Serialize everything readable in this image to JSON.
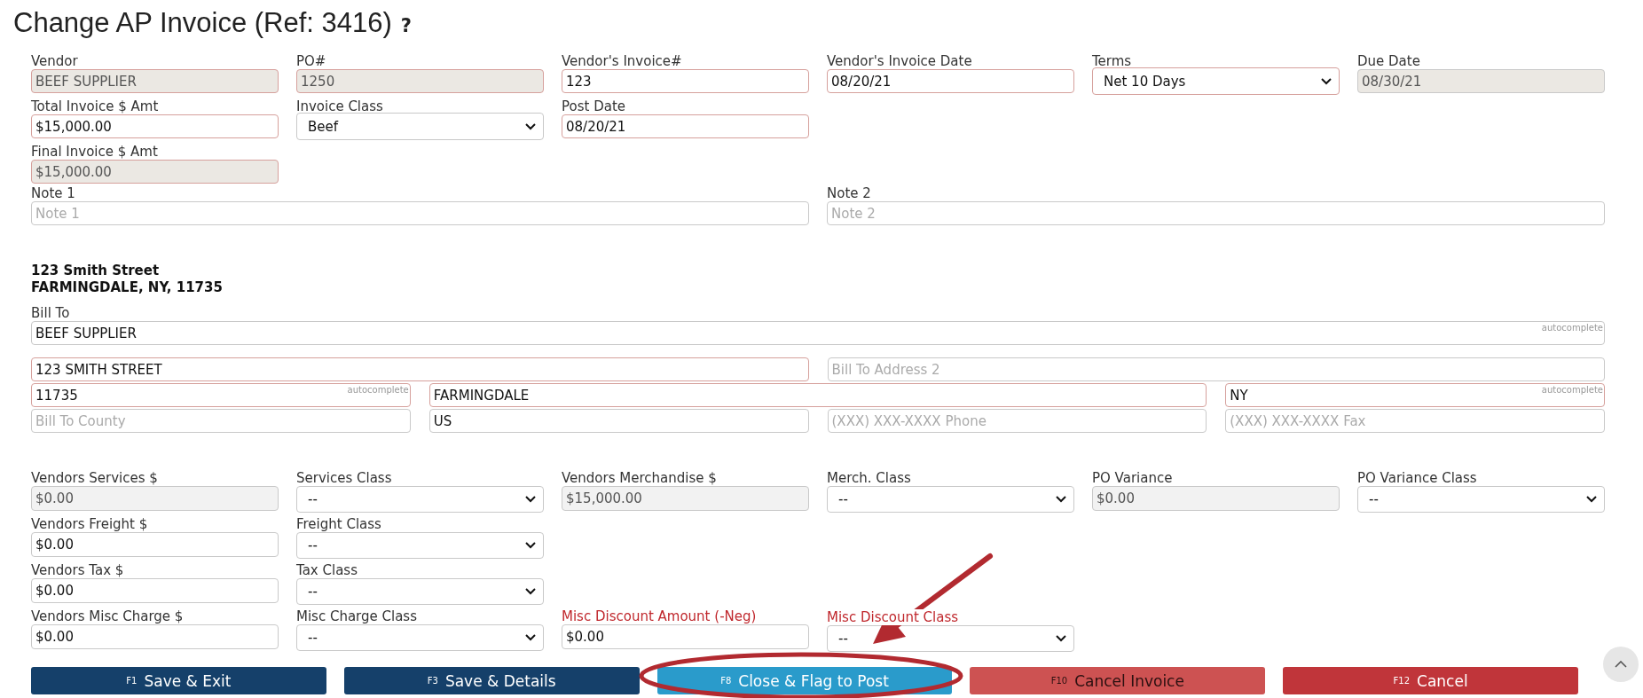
{
  "title": "Change AP Invoice (Ref: 3416)",
  "help": "?",
  "header_rows": [
    [
      {
        "label": "Vendor",
        "kind": "input",
        "value": "BEEF SUPPLIER",
        "readonly": true,
        "required": true
      },
      {
        "label": "PO#",
        "kind": "input",
        "value": "1250",
        "readonly": true,
        "required": true
      },
      {
        "label": "Vendor's Invoice#",
        "kind": "input",
        "value": "123",
        "readonly": false,
        "required": true
      },
      {
        "label": "Vendor's Invoice Date",
        "kind": "input",
        "value": "08/20/21",
        "readonly": false,
        "required": true
      },
      {
        "label": "Terms",
        "kind": "select",
        "value": "Net 10 Days",
        "required": true
      },
      {
        "label": "Due Date",
        "kind": "input",
        "value": "08/30/21",
        "readonly": true,
        "required": false
      }
    ],
    [
      {
        "label": "Total Invoice $ Amt",
        "kind": "input",
        "value": "$15,000.00",
        "readonly": false,
        "required": true
      },
      {
        "label": "Invoice Class",
        "kind": "select",
        "value": "Beef",
        "required": false
      },
      {
        "label": "Post Date",
        "kind": "input",
        "value": "08/20/21",
        "readonly": false,
        "required": true
      }
    ],
    [
      {
        "label": "Final Invoice $ Amt",
        "kind": "input",
        "value": "$15,000.00",
        "readonly": true,
        "required": true
      }
    ]
  ],
  "notes": [
    {
      "label": "Note 1",
      "kind": "input",
      "placeholder": "Note 1",
      "readonly": false,
      "required": false
    },
    {
      "label": "Note 2",
      "kind": "input",
      "placeholder": "Note 2",
      "readonly": false,
      "required": false
    }
  ],
  "vendor_address": [
    "123 Smith Street",
    "FARMINGDALE, NY, 11735"
  ],
  "bill_to_fields": [
    {
      "label": "Bill To",
      "kind": "input",
      "value": "BEEF SUPPLIER",
      "hint": "autocomplete",
      "readonly": false,
      "required": false
    },
    {
      "kind": "input",
      "value": "123 SMITH STREET",
      "readonly": false,
      "required": true
    },
    {
      "kind": "input",
      "placeholder": "Bill To Address 2",
      "readonly": false,
      "required": false
    },
    {
      "kind": "input",
      "value": "11735",
      "hint": "autocomplete",
      "readonly": false,
      "required": true
    },
    {
      "kind": "input",
      "value": "FARMINGDALE",
      "readonly": false,
      "required": true
    },
    {
      "kind": "input",
      "value": "NY",
      "hint": "autocomplete",
      "readonly": false,
      "required": true
    },
    {
      "kind": "input",
      "placeholder": "Bill To County",
      "readonly": false,
      "required": false
    },
    {
      "kind": "input",
      "value": "US",
      "readonly": false,
      "required": false
    },
    {
      "kind": "input",
      "placeholder": "(XXX) XXX-XXXX Phone",
      "readonly": false,
      "required": false
    },
    {
      "kind": "input",
      "placeholder": "(XXX) XXX-XXXX Fax",
      "readonly": false,
      "required": false
    }
  ],
  "charge_rows": [
    [
      {
        "label": "Vendors Services $",
        "kind": "input",
        "value": "$0.00",
        "readonly": true,
        "required": false
      },
      {
        "label": "Services Class",
        "kind": "select",
        "value": "--",
        "required": false
      },
      {
        "label": "Vendors Merchandise $",
        "kind": "input",
        "value": "$15,000.00",
        "readonly": true,
        "required": false
      },
      {
        "label": "Merch. Class",
        "kind": "select",
        "value": "--",
        "required": false
      },
      {
        "label": "PO Variance",
        "kind": "input",
        "value": "$0.00",
        "readonly": true,
        "required": false
      },
      {
        "label": "PO Variance Class",
        "kind": "select",
        "value": "--",
        "required": false
      }
    ],
    [
      {
        "label": "Vendors Freight $",
        "kind": "input",
        "value": "$0.00",
        "readonly": false,
        "required": false
      },
      {
        "label": "Freight Class",
        "kind": "select",
        "value": "--",
        "required": false
      }
    ],
    [
      {
        "label": "Vendors Tax $",
        "kind": "input",
        "value": "$0.00",
        "readonly": false,
        "required": false
      },
      {
        "label": "Tax Class",
        "kind": "select",
        "value": "--",
        "required": false
      }
    ],
    [
      {
        "label": "Vendors Misc Charge $",
        "kind": "input",
        "value": "$0.00",
        "readonly": false,
        "required": false
      },
      {
        "label": "Misc Charge Class",
        "kind": "select",
        "value": "--",
        "required": false
      },
      {
        "label": "Misc Discount Amount (-Neg)",
        "label_alert": true,
        "kind": "input",
        "value": "$0.00",
        "readonly": false,
        "required": false
      },
      {
        "label": "Misc Discount Class",
        "label_alert": true,
        "kind": "select",
        "value": "--",
        "required": false
      }
    ]
  ],
  "buttons": [
    {
      "key": "F1",
      "label": "Save & Exit",
      "kind": "primary"
    },
    {
      "key": "F3",
      "label": "Save & Details",
      "kind": "primary"
    },
    {
      "key": "F8",
      "label": "Close & Flag to Post",
      "kind": "info"
    },
    {
      "key": "F10",
      "label": "Cancel Invoice",
      "kind": "warning"
    },
    {
      "key": "F12",
      "label": "Cancel",
      "kind": "danger"
    }
  ]
}
